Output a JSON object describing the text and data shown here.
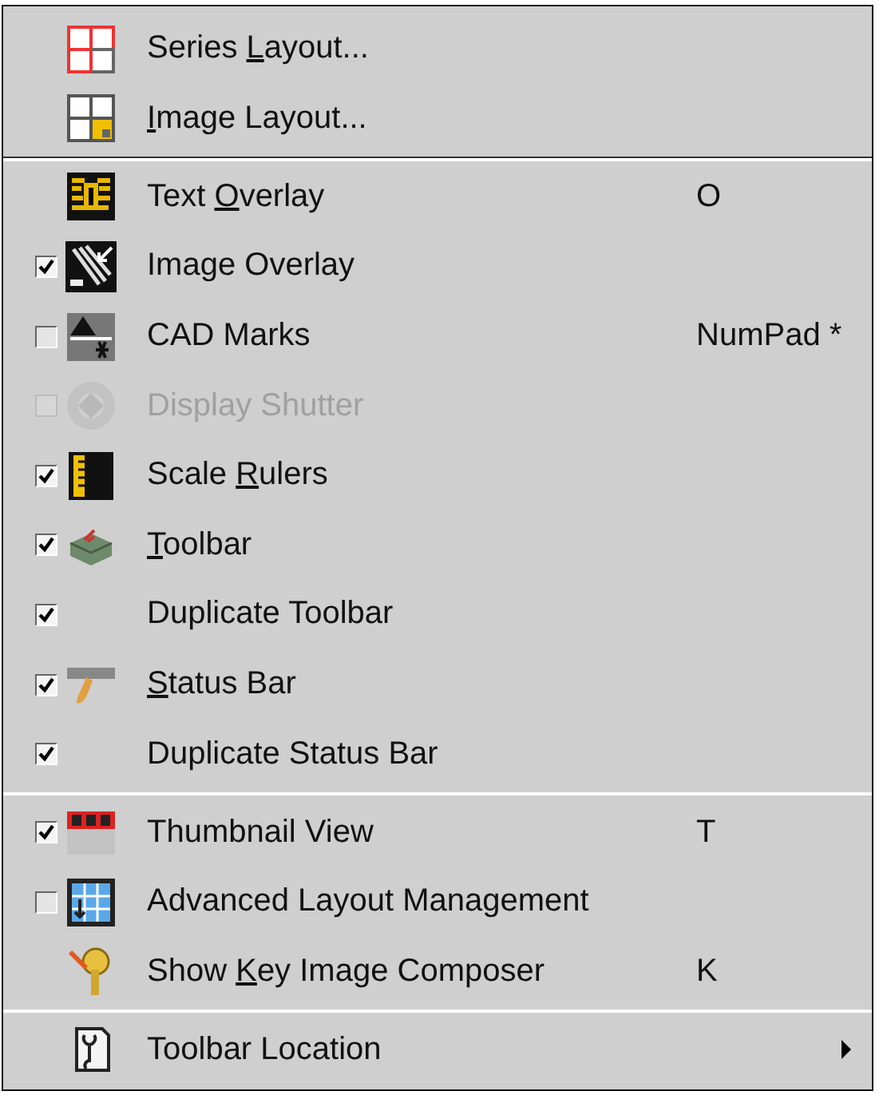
{
  "menu": {
    "groups": [
      {
        "items": [
          {
            "kind": "command",
            "label_start": "Series ",
            "mnemonic": "L",
            "label_end": "ayout..."
          },
          {
            "kind": "command",
            "mnemonic": "I",
            "label_end": "mage Layout..."
          }
        ]
      },
      {
        "items": [
          {
            "kind": "command",
            "label_start": "Text ",
            "mnemonic": "O",
            "label_end": "verlay",
            "shortcut": "O"
          },
          {
            "kind": "checkable",
            "label_start": "Image Overlay",
            "checked": true,
            "disabled": false
          },
          {
            "kind": "checkable",
            "label_start": "CAD Marks",
            "checked": false,
            "disabled": false,
            "shortcut": "NumPad *"
          },
          {
            "kind": "checkable",
            "label_start": "Display Shutter",
            "checked": false,
            "disabled": true
          },
          {
            "kind": "checkable",
            "label_start": "Scale ",
            "mnemonic": "R",
            "label_end": "ulers",
            "checked": true,
            "disabled": false
          },
          {
            "kind": "checkable",
            "mnemonic": "T",
            "label_end": "oolbar",
            "checked": true,
            "disabled": false
          },
          {
            "kind": "checkable",
            "label_start": "Duplicate Toolbar",
            "checked": true,
            "disabled": false
          },
          {
            "kind": "checkable",
            "mnemonic": "S",
            "label_end": "tatus Bar",
            "checked": true,
            "disabled": false
          },
          {
            "kind": "checkable",
            "label_start": "Duplicate Status Bar",
            "checked": true,
            "disabled": false
          }
        ]
      },
      {
        "items": [
          {
            "kind": "checkable",
            "label_start": "Thumbnail View",
            "checked": true,
            "disabled": false,
            "shortcut": "T"
          },
          {
            "kind": "checkable",
            "label_start": "Advanced Layout Management",
            "checked": false,
            "disabled": false
          },
          {
            "kind": "command",
            "label_start": "Show ",
            "mnemonic": "K",
            "label_end": "ey Image Composer",
            "shortcut": "K"
          }
        ]
      },
      {
        "items": [
          {
            "kind": "submenu",
            "label_start": "Toolbar Location"
          }
        ]
      }
    ]
  }
}
